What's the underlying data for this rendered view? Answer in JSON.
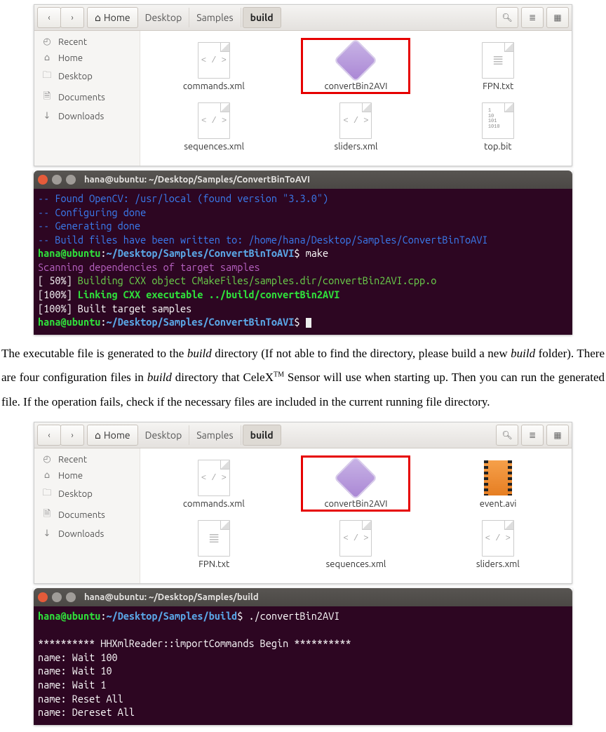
{
  "fm1": {
    "breadcrumbs": {
      "home": "Home",
      "b1": "Desktop",
      "b2": "Samples",
      "b3": "build"
    },
    "sidebar": [
      {
        "icon": "clock-icon",
        "label": "Recent"
      },
      {
        "icon": "home-icon",
        "label": "Home"
      },
      {
        "icon": "folder-icon",
        "label": "Desktop"
      },
      {
        "icon": "doc-icon",
        "label": "Documents"
      },
      {
        "icon": "download-icon",
        "label": "Downloads"
      }
    ],
    "row1": [
      {
        "type": "code",
        "label": "commands.xml"
      },
      {
        "type": "exec",
        "label": "convertBin2AVI",
        "highlight": true
      },
      {
        "type": "txt",
        "label": "FPN.txt"
      }
    ],
    "row2": [
      {
        "type": "code",
        "label": "sequences.xml"
      },
      {
        "type": "code",
        "label": "sliders.xml"
      },
      {
        "type": "bin",
        "label": "top.bit"
      }
    ]
  },
  "term1": {
    "title": "hana@ubuntu: ~/Desktop/Samples/ConvertBinToAVI",
    "l1": "-- Found OpenCV: /usr/local (found version \"3.3.0\")",
    "l2": "-- Configuring done",
    "l3": "-- Generating done",
    "l4": "-- Build files have been written to: /home/hana/Desktop/Samples/ConvertBinToAVI",
    "user": "hana@ubuntu",
    "path": "~/Desktop/Samples/ConvertBinToAVI",
    "cmd1": "make",
    "scan": "Scanning dependencies of target samples",
    "p50": "[ 50%] ",
    "build": "Building CXX object CMakeFiles/samples.dir/convertBin2AVI.cpp.o",
    "p100a": "[100%] ",
    "link": "Linking CXX executable ../build/convertBin2AVI",
    "p100b": "[100%] Built target samples"
  },
  "doc": {
    "p1a": "The executable file is generated to the ",
    "p1b": "build",
    "p1c": " directory (If not able to find the directory, please build a new ",
    "p1d": "build",
    "p1e": " folder). There are four configuration files in ",
    "p1f": "build",
    "p1g": " directory that CeleX",
    "p1h": "TM",
    "p1i": " Sensor will use when starting up. Then you can run the generated file. If the operation fails, check if the necessary files are included in the current running file directory."
  },
  "fm2": {
    "breadcrumbs": {
      "home": "Home",
      "b1": "Desktop",
      "b2": "Samples",
      "b3": "build"
    },
    "row1": [
      {
        "type": "code",
        "label": "commands.xml"
      },
      {
        "type": "exec",
        "label": "convertBin2AVI",
        "highlight": true
      },
      {
        "type": "avi",
        "label": "event.avi"
      }
    ],
    "row2": [
      {
        "type": "txt",
        "label": "FPN.txt"
      },
      {
        "type": "code",
        "label": "sequences.xml"
      },
      {
        "type": "code",
        "label": "sliders.xml"
      }
    ]
  },
  "term2": {
    "title": "hana@ubuntu: ~/Desktop/Samples/build",
    "user": "hana@ubuntu",
    "path": "~/Desktop/Samples/build",
    "cmd": "./convertBin2AVI",
    "blank": "",
    "l1": "********** HHXmlReader::importCommands Begin **********",
    "l2": "name: Wait 100",
    "l3": "name: Wait 10",
    "l4": "name: Wait 1",
    "l5": "name: Reset All",
    "l6": "name: Dereset All"
  }
}
